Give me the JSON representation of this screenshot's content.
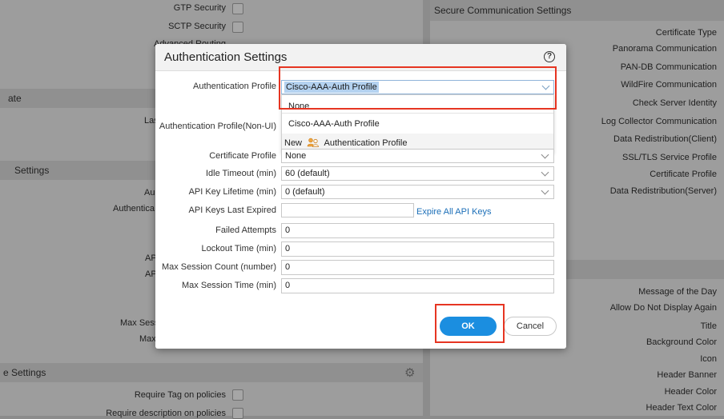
{
  "background": {
    "left_top_rows": [
      {
        "label": "GTP Security"
      },
      {
        "label": "SCTP Security"
      },
      {
        "label": "Advanced Routing"
      }
    ],
    "section_ate": "ate",
    "las_label": "Las",
    "settings_section": "Settings",
    "au_label": "Au",
    "authentica_label": "Authentica",
    "ap_label_1": "AP",
    "ap_label_2": "AP",
    "max_sess_label": "Max Sess",
    "max_label": "Max",
    "e_settings_section": "e Settings",
    "bottom_rows": [
      {
        "label": "Require Tag on policies"
      },
      {
        "label": "Require description on policies"
      }
    ],
    "secure_comm": {
      "title": "Secure Communication Settings",
      "items": [
        "Certificate Type",
        "Panorama Communication",
        "PAN-DB Communication",
        "WildFire Communication",
        "Check Server Identity",
        "Log Collector Communication",
        "Data Redistribution(Client)",
        "SSL/TLS Service Profile",
        "Certificate Profile",
        "Data Redistribution(Server)"
      ]
    },
    "banner_items": [
      "Message of the Day",
      "Allow Do Not Display Again",
      "Title",
      "Background Color",
      "Icon",
      "Header Banner",
      "Header Color",
      "Header Text Color"
    ]
  },
  "dialog": {
    "title": "Authentication Settings",
    "help_icon": "help-icon",
    "auth_profile_label": "Authentication Profile",
    "auth_profile_value": "Cisco-AAA-Auth Profile",
    "dropdown": {
      "none": "None",
      "cisco": "Cisco-AAA-Auth Profile",
      "new_prefix": "New",
      "new_suffix": "Authentication Profile"
    },
    "auth_profile_nonui_label": "Authentication Profile(Non-UI)",
    "cert_profile_label": "Certificate Profile",
    "cert_profile_value": "None",
    "idle_timeout_label": "Idle Timeout (min)",
    "idle_timeout_value": "60 (default)",
    "api_key_lifetime_label": "API Key Lifetime (min)",
    "api_key_lifetime_value": "0 (default)",
    "api_keys_expired_label": "API Keys Last Expired",
    "api_keys_expired_value": "",
    "expire_link": "Expire All API Keys",
    "failed_attempts_label": "Failed Attempts",
    "failed_attempts_value": "0",
    "lockout_label": "Lockout Time (min)",
    "lockout_value": "0",
    "max_session_count_label": "Max Session Count (number)",
    "max_session_count_value": "0",
    "max_session_time_label": "Max Session Time (min)",
    "max_session_time_value": "0",
    "ok_label": "OK",
    "cancel_label": "Cancel"
  },
  "colors": {
    "primary_button": "#1b8ee0",
    "highlight_annotation": "#e63522",
    "link": "#1c6fb8"
  }
}
